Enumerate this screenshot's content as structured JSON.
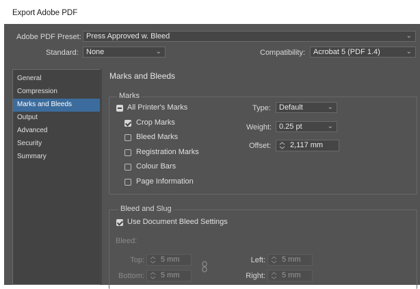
{
  "window": {
    "title": "Export Adobe PDF"
  },
  "top": {
    "preset_label": "Adobe PDF Preset:",
    "preset_value": "Press Approved w. Bleed",
    "standard_label": "Standard:",
    "standard_value": "None",
    "compat_label": "Compatibility:",
    "compat_value": "Acrobat 5 (PDF 1.4)"
  },
  "sidebar": {
    "items": [
      {
        "label": "General"
      },
      {
        "label": "Compression"
      },
      {
        "label": "Marks and Bleeds",
        "selected": true
      },
      {
        "label": "Output"
      },
      {
        "label": "Advanced"
      },
      {
        "label": "Security"
      },
      {
        "label": "Summary"
      }
    ]
  },
  "main": {
    "heading": "Marks and Bleeds",
    "marks": {
      "group_label": "Marks",
      "all_printers": {
        "label": "All Printer's Marks",
        "state": "mixed"
      },
      "options": [
        {
          "label": "Crop Marks",
          "checked": true
        },
        {
          "label": "Bleed Marks",
          "checked": false
        },
        {
          "label": "Registration Marks",
          "checked": false
        },
        {
          "label": "Colour Bars",
          "checked": false
        },
        {
          "label": "Page Information",
          "checked": false
        }
      ],
      "type_label": "Type:",
      "type_value": "Default",
      "weight_label": "Weight:",
      "weight_value": "0.25 pt",
      "offset_label": "Offset:",
      "offset_value": "2,117 mm"
    },
    "bleed": {
      "group_label": "Bleed and Slug",
      "use_doc_label": "Use Document Bleed Settings",
      "use_doc_checked": true,
      "bleed_label": "Bleed:",
      "top_label": "Top:",
      "top_value": "5 mm",
      "bottom_label": "Bottom:",
      "bottom_value": "5 mm",
      "left_label": "Left:",
      "left_value": "5 mm",
      "right_label": "Right:",
      "right_value": "5 mm"
    }
  },
  "colors": {
    "dialog_bg": "#535353",
    "selection": "#3c6c9d"
  },
  "icons": [
    "chevron-down-icon",
    "checkbox-icon",
    "spinner-arrows-icon",
    "chain-link-icon"
  ]
}
